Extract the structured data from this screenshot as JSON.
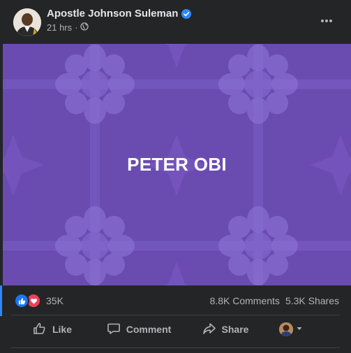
{
  "post": {
    "author": "Apostle Johnson Suleman",
    "time": "21 hrs",
    "time_separator": "·",
    "image_text": "PETER OBI",
    "background_color": "#6a4bb0"
  },
  "reactions": {
    "count": "35K",
    "icons": [
      "like-icon",
      "love-icon"
    ]
  },
  "stats": {
    "comments": "8.8K Comments",
    "shares": "5.3K Shares"
  },
  "actions": {
    "like": "Like",
    "comment": "Comment",
    "share": "Share"
  },
  "colors": {
    "card_bg": "#242526",
    "text_primary": "#e4e6eb",
    "text_secondary": "#b0b3b8",
    "like_blue": "#1877f2",
    "love_red": "#f33e58"
  }
}
